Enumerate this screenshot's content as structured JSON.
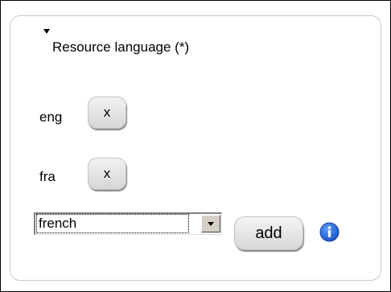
{
  "section": {
    "title": "Resource language (*)",
    "collapse_icon": "triangle-down-icon"
  },
  "languages": [
    {
      "code": "eng",
      "remove_label": "x"
    },
    {
      "code": "fra",
      "remove_label": "x"
    }
  ],
  "selector": {
    "selected_value": "french",
    "arrow_icon": "chevron-down-icon"
  },
  "add_label": "add",
  "info_icon": "info-icon",
  "colors": {
    "info_blue": "#1a63d6",
    "panel_border": "#c8c8c8"
  }
}
